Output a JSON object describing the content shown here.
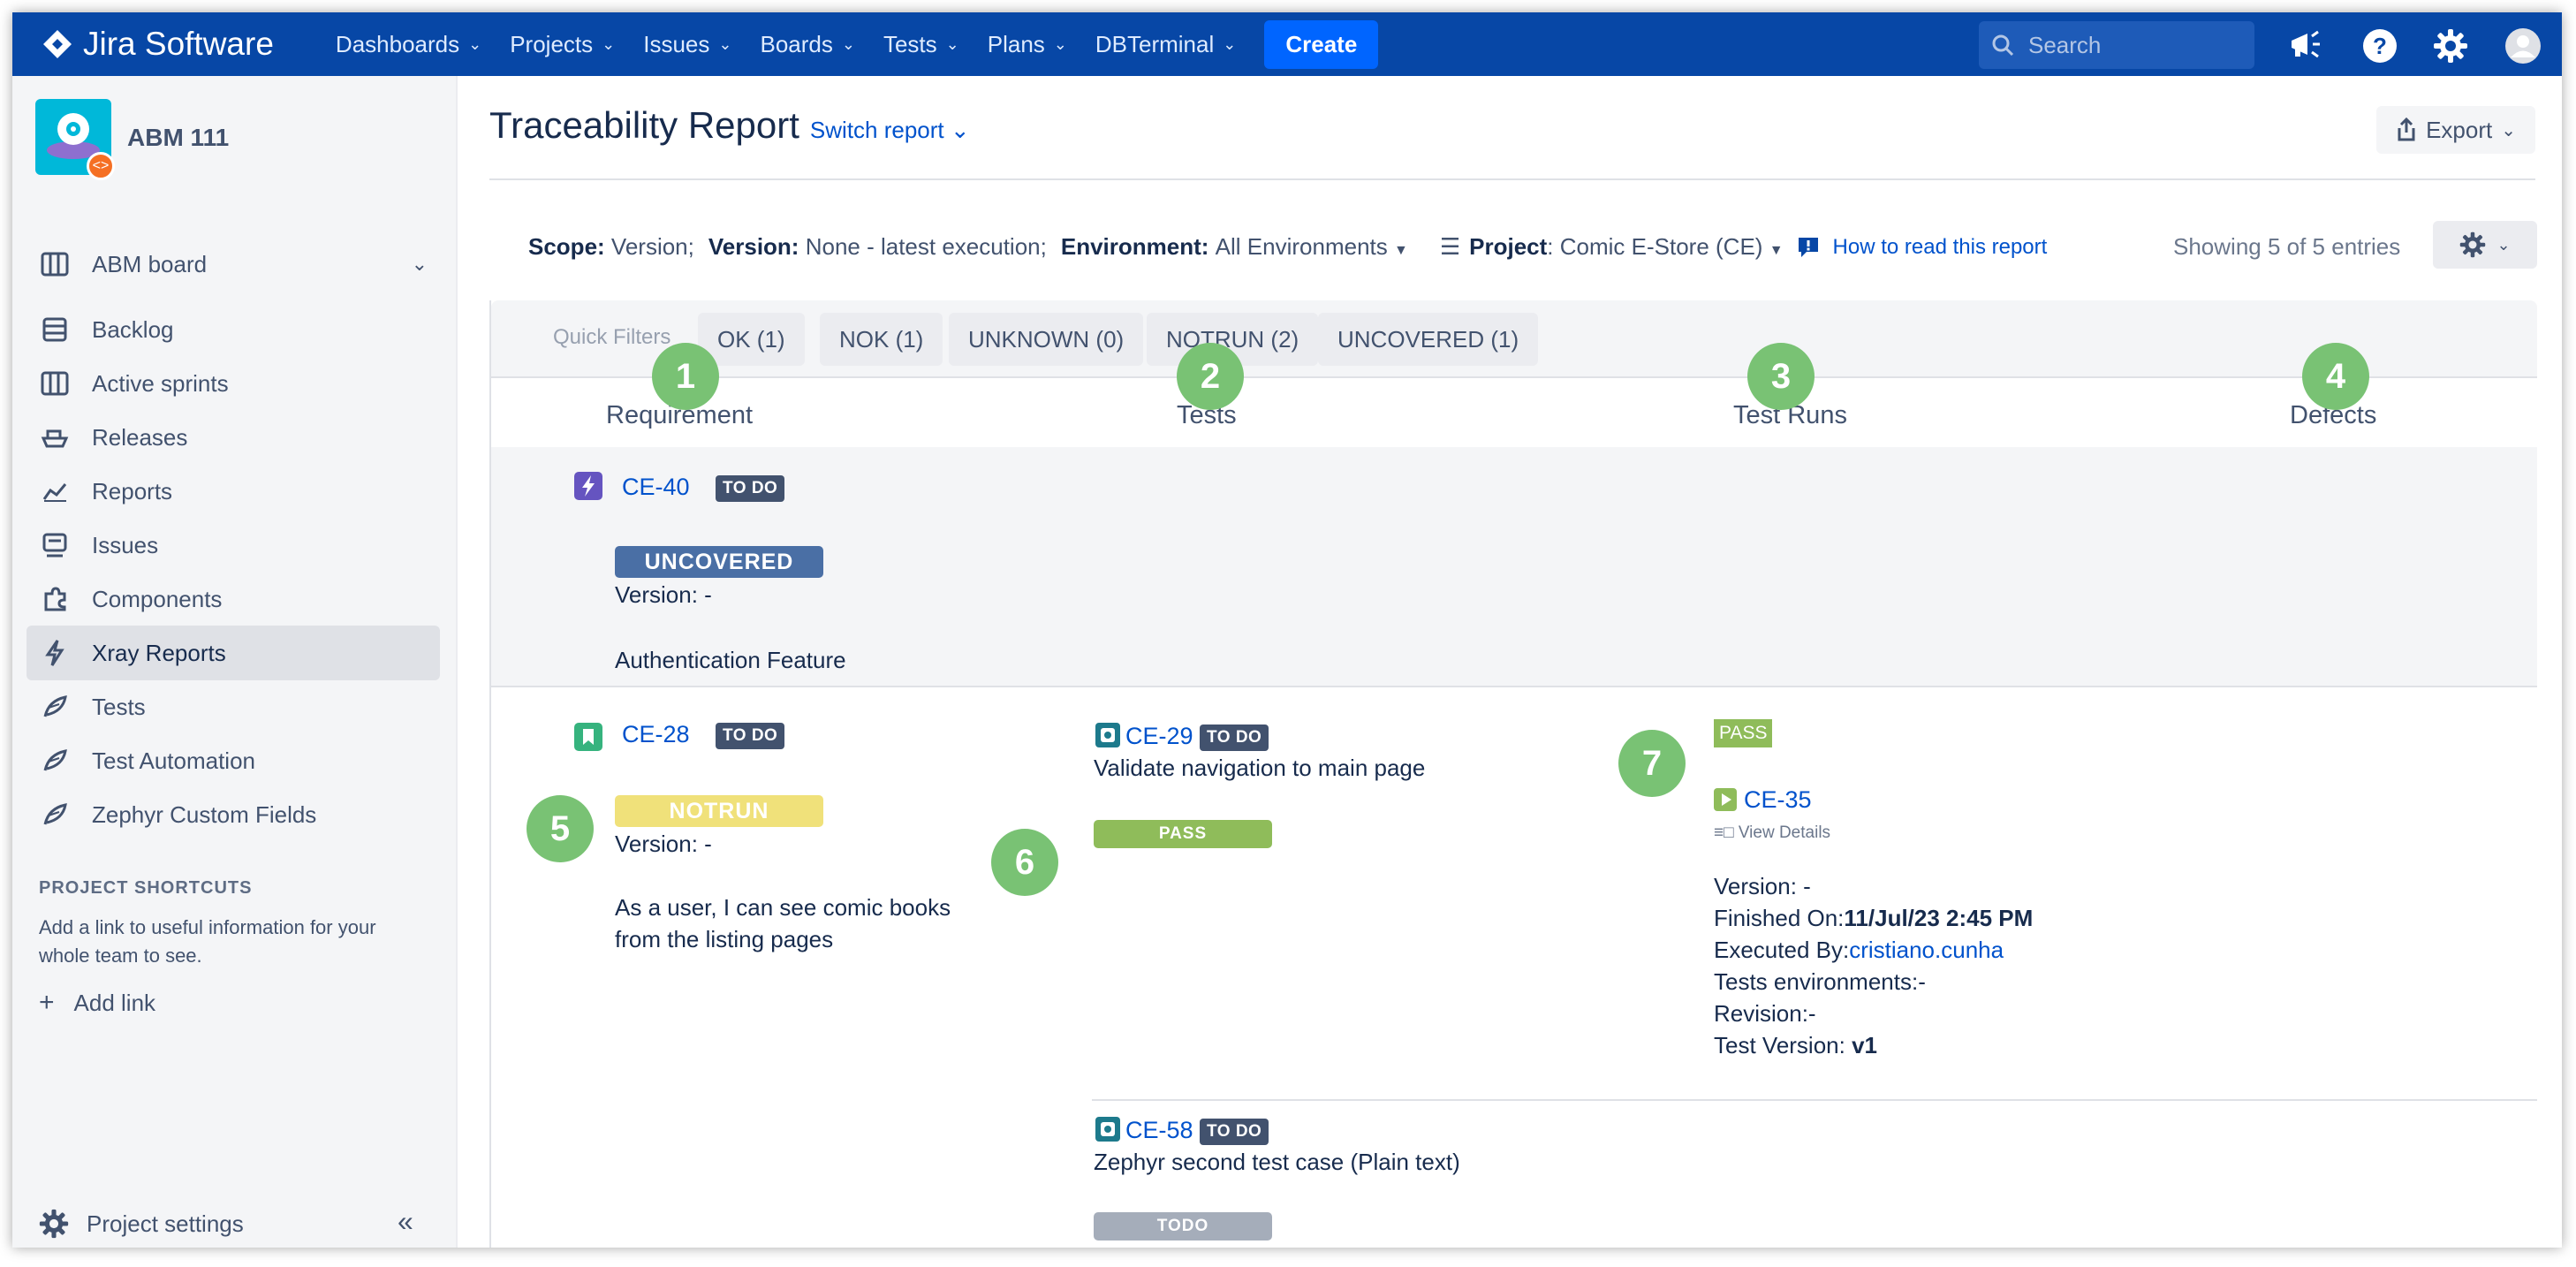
{
  "topnav": {
    "brand": "Jira Software",
    "items": [
      "Dashboards",
      "Projects",
      "Issues",
      "Boards",
      "Tests",
      "Plans",
      "DBTerminal"
    ],
    "create_label": "Create",
    "search_placeholder": "Search"
  },
  "sidebar": {
    "project_name": "ABM 111",
    "board_label": "ABM board",
    "items": [
      "Backlog",
      "Active sprints",
      "Releases",
      "Reports",
      "Issues",
      "Components",
      "Xray Reports",
      "Tests",
      "Test Automation",
      "Zephyr Custom Fields"
    ],
    "active_item": "Xray Reports",
    "shortcuts_title": "PROJECT SHORTCUTS",
    "shortcuts_desc": "Add a link to useful information for your whole team to see.",
    "add_link_label": "Add link",
    "settings_label": "Project settings"
  },
  "report": {
    "title": "Traceability Report",
    "switch_label": "Switch report",
    "export_label": "Export",
    "scope_label": "Scope:",
    "scope_value": "Version;",
    "version_label": "Version:",
    "version_value": "None - latest execution;",
    "environment_label": "Environment:",
    "environment_value": "All Environments",
    "project_label": "Project",
    "project_value": ": Comic E-Store (CE)",
    "how_to_read": "How to read this report",
    "showing": "Showing 5 of 5 entries"
  },
  "quick_filters": {
    "label": "Quick Filters",
    "items": [
      "OK (1)",
      "NOK (1)",
      "UNKNOWN (0)",
      "NOTRUN (2)",
      "UNCOVERED (1)"
    ]
  },
  "columns": [
    "Requirement",
    "Tests",
    "Test Runs",
    "Defects"
  ],
  "badges": [
    "1",
    "2",
    "3",
    "4",
    "5",
    "6",
    "7"
  ],
  "rows": [
    {
      "key": "CE-40",
      "status": "TO DO",
      "coverage": "UNCOVERED",
      "coverage_color": "#4a6fa5",
      "version": "Version: -",
      "summary": "Authentication Feature"
    },
    {
      "key": "CE-28",
      "status": "TO DO",
      "coverage": "NOTRUN",
      "coverage_color": "#f0e17a",
      "version": "Version: -",
      "summary_line1": "As a user, I can see comic books",
      "summary_line2": "from the listing pages",
      "tests": [
        {
          "key": "CE-29",
          "status": "TO DO",
          "summary": "Validate navigation to main page",
          "result": "PASS",
          "result_color": "#8fbc5a",
          "run": {
            "badge": "PASS",
            "key": "CE-35",
            "view_details": "View Details",
            "version": "Version: -",
            "finished_label": "Finished On:",
            "finished_value": "11/Jul/23 2:45 PM",
            "executed_label": "Executed By:",
            "executed_value": "cristiano.cunha",
            "environments": "Tests environments:-",
            "revision": "Revision:-",
            "test_version_label": "Test Version: ",
            "test_version_value": "v1"
          }
        },
        {
          "key": "CE-58",
          "status": "TO DO",
          "summary": "Zephyr second test case (Plain text)",
          "result": "TODO",
          "result_color": "#a5adba"
        }
      ]
    }
  ]
}
